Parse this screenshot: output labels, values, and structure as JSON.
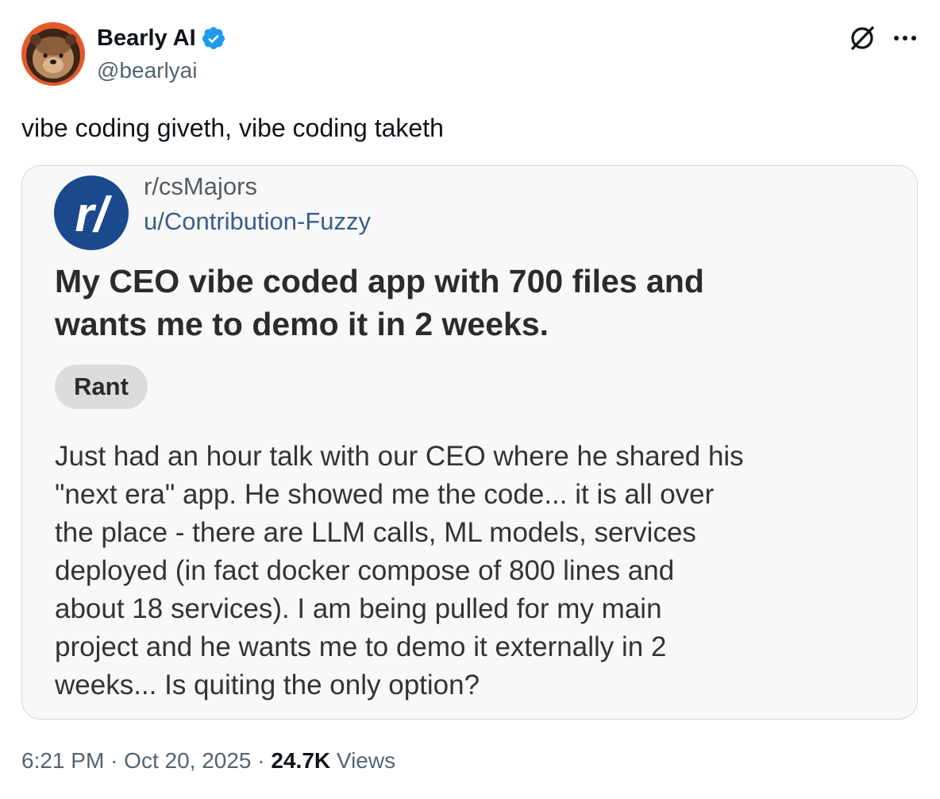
{
  "author": {
    "name": "Bearly AI",
    "handle": "@bearlyai",
    "verified": true,
    "avatar_icon": "bear-avatar-icon"
  },
  "actions": {
    "grok_icon": "grok-icon",
    "more_icon": "more-icon"
  },
  "tweet": {
    "text": "vibe coding giveth, vibe coding taketh"
  },
  "media": {
    "subreddit": "r/csMajors",
    "user": "u/Contribution-Fuzzy",
    "title_lines": [
      "My CEO vibe coded app with 700 files and",
      "wants me to demo it in 2 weeks."
    ],
    "flair": "Rant",
    "body_lines": [
      "Just had an hour talk with our CEO where he shared his",
      "\"next era\" app. He showed me the code... it is all over",
      "the place - there are LLM calls, ML models, services",
      "deployed (in fact docker compose of 800 lines and",
      "about 18 services). I am being pulled for my main",
      "project and he wants me to demo it externally in 2",
      "weeks... Is quiting the only option?"
    ]
  },
  "meta": {
    "time": "6:21 PM",
    "separator": "·",
    "date": "Oct 20, 2025",
    "views_count": "24.7K",
    "views_label": "Views"
  },
  "colors": {
    "verified_blue": "#1d9bf0",
    "reddit_logo_blue": "#1a4a8c",
    "muted_text": "#536471"
  }
}
